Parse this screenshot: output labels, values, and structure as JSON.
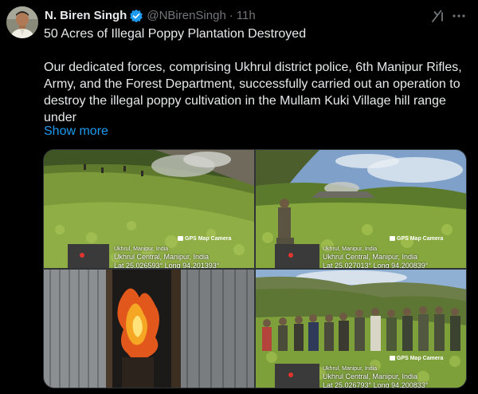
{
  "tweet": {
    "author_name": "N. Biren Singh",
    "handle": "@NBirenSingh",
    "separator": "·",
    "time": "11h",
    "headline": "50 Acres of Illegal Poppy Plantation Destroyed",
    "body": "Our dedicated forces, comprising Ukhrul district police, 6th Manipur Rifles, Army, and the Forest Department, successfully carried out an operation to destroy the illegal poppy cultivation in the Mullam Kuki Village hill range under",
    "show_more": "Show more"
  },
  "icons": {
    "verified": "verified-badge-icon",
    "grok": "grok-icon",
    "more": "more-options-icon"
  },
  "colors": {
    "background": "#000000",
    "text": "#e7e9ea",
    "muted": "#71767b",
    "link": "#1d9bf0",
    "verified": "#1d9bf0"
  },
  "media": {
    "photos": [
      {
        "gps_label": "GPS Map Camera",
        "place_small": "Ukhrul, Manipur, India",
        "place_big": "Ukhrul Central, Manipur, India",
        "coords": "Lat 25.026593° Long 94.201393°"
      },
      {
        "gps_label": "GPS Map Camera",
        "place_small": "Ukhrul, Manipur, India",
        "place_big": "Ukhrul Central, Manipur, India",
        "coords": "Lat 25.027013° Long 94.200839°"
      },
      {
        "gps_label": "",
        "place_small": "",
        "place_big": "",
        "coords": ""
      },
      {
        "gps_label": "GPS Map Camera",
        "place_small": "Ukhrul, Manipur, India",
        "place_big": "Ukhrul Central, Manipur, India",
        "coords": "Lat 25.026793° Long 94.200833°"
      }
    ]
  }
}
